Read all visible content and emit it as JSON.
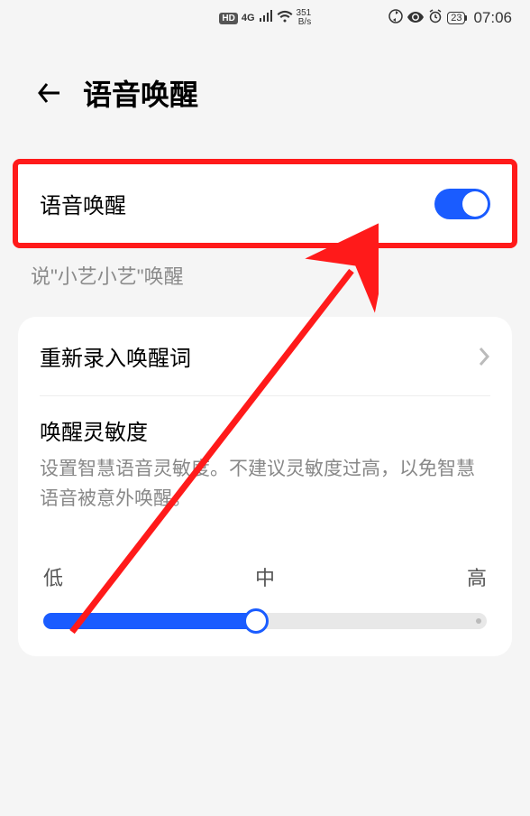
{
  "statusBar": {
    "hd": "HD",
    "netGen": "4G",
    "netSpeed1": "351",
    "netSpeed2": "B/s",
    "battery": "23",
    "time": "07:06"
  },
  "header": {
    "title": "语音唤醒"
  },
  "toggle": {
    "label": "语音唤醒",
    "on": true
  },
  "hint": "说\"小艺小艺\"唤醒",
  "reRecord": {
    "label": "重新录入唤醒词"
  },
  "sensitivity": {
    "title": "唤醒灵敏度",
    "desc": "设置智慧语音灵敏度。不建议灵敏度过高，以免智慧语音被意外唤醒。",
    "low": "低",
    "mid": "中",
    "high": "高"
  }
}
